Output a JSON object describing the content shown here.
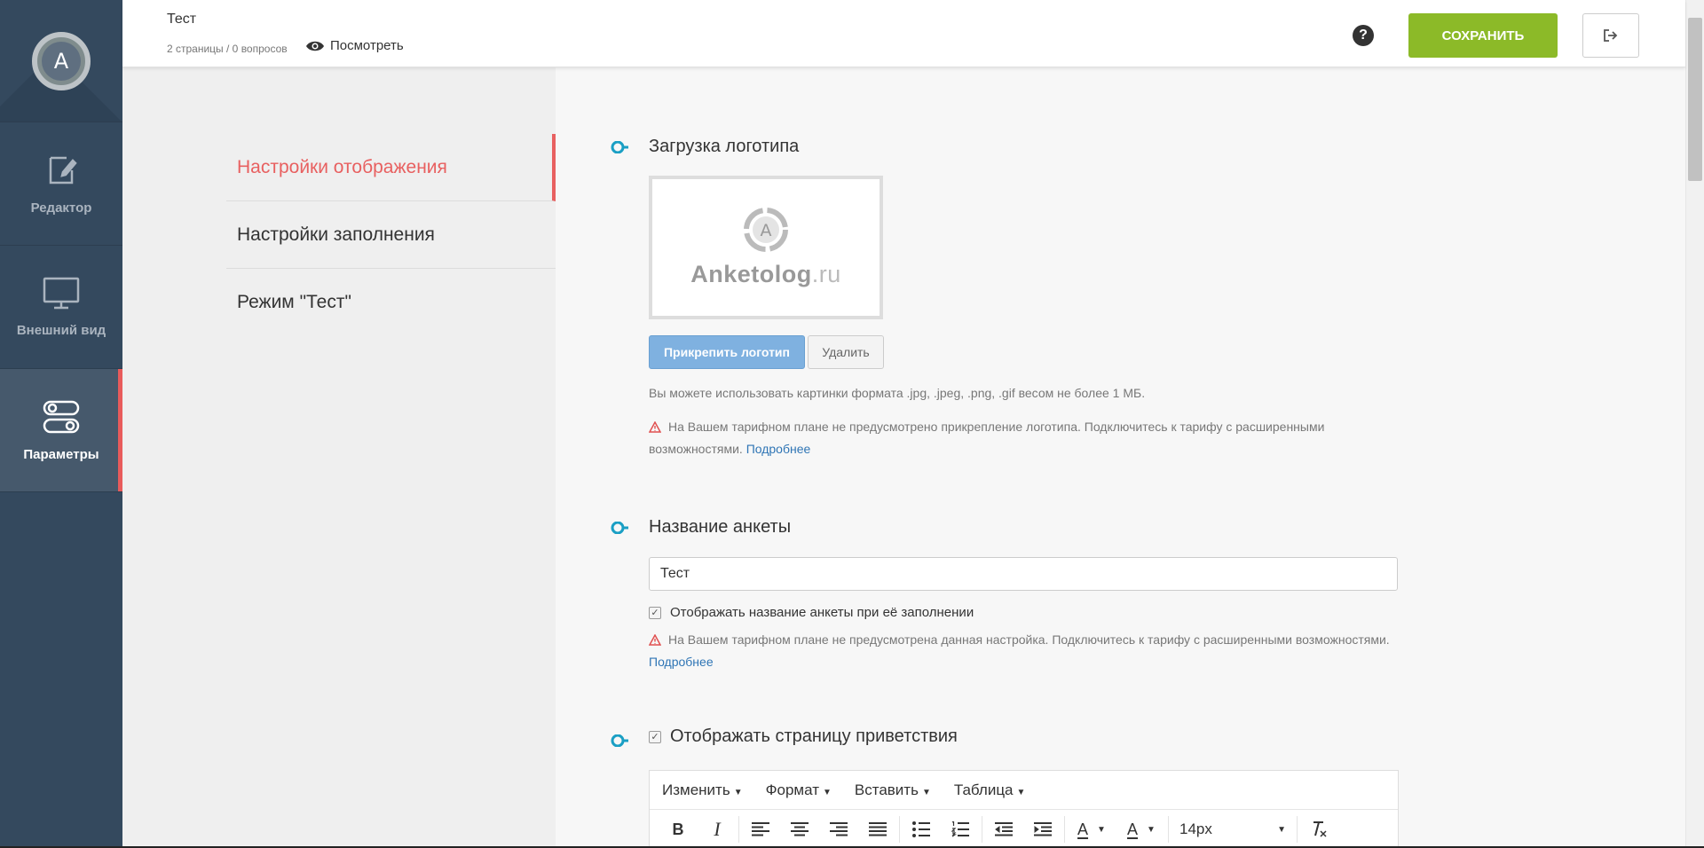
{
  "sidebar": {
    "logo_letter": "A",
    "items": [
      {
        "label": "Редактор",
        "icon": "edit-icon",
        "active": false
      },
      {
        "label": "Внешний вид",
        "icon": "monitor-icon",
        "active": false
      },
      {
        "label": "Параметры",
        "icon": "toggles-icon",
        "active": true
      }
    ]
  },
  "topbar": {
    "title": "Тест",
    "meta": "2 страницы / 0 вопросов",
    "preview_label": "Посмотреть",
    "help_label": "?",
    "save_label": "СОХРАНИТЬ"
  },
  "settings_nav": {
    "items": [
      {
        "label": "Настройки отображения",
        "active": true
      },
      {
        "label": "Настройки заполнения",
        "active": false
      },
      {
        "label": "Режим \"Тест\"",
        "active": false
      }
    ]
  },
  "logo_section": {
    "title": "Загрузка логотипа",
    "logo_brand": "Anketolog",
    "logo_tld": ".ru",
    "logo_letter": "A",
    "attach_label": "Прикрепить логотип",
    "delete_label": "Удалить",
    "hint": "Вы можете использовать картинки формата .jpg, .jpeg, .png, .gif весом не более 1 МБ.",
    "warning": "На Вашем тарифном плане не предусмотрено прикрепление логотипа. Подключитесь к тарифу с расширенными возможностями.",
    "more_link": "Подробнее"
  },
  "name_section": {
    "title": "Название анкеты",
    "input_value": "Тест",
    "checkbox_label": "Отображать название анкеты при её заполнении",
    "checkbox_checked": true,
    "warning": "На Вашем тарифном плане не предусмотрена данная настройка. Подключитесь к тарифу с расширенными возможностями.",
    "more_link": "Подробнее"
  },
  "welcome_section": {
    "checkbox_label": "Отображать страницу приветствия",
    "checkbox_checked": true
  },
  "editor": {
    "menu": [
      "Изменить",
      "Формат",
      "Вставить",
      "Таблица"
    ],
    "font_size": "14px",
    "bold_label": "B",
    "italic_label": "I",
    "color_label": "A"
  },
  "colors": {
    "sidebar_bg": "#34495e",
    "accent_red": "#e86060",
    "save_green": "#8cba28",
    "attach_blue": "#7fb1e0",
    "section_dot": "#1a9fc4",
    "link_blue": "#2f75b5"
  }
}
